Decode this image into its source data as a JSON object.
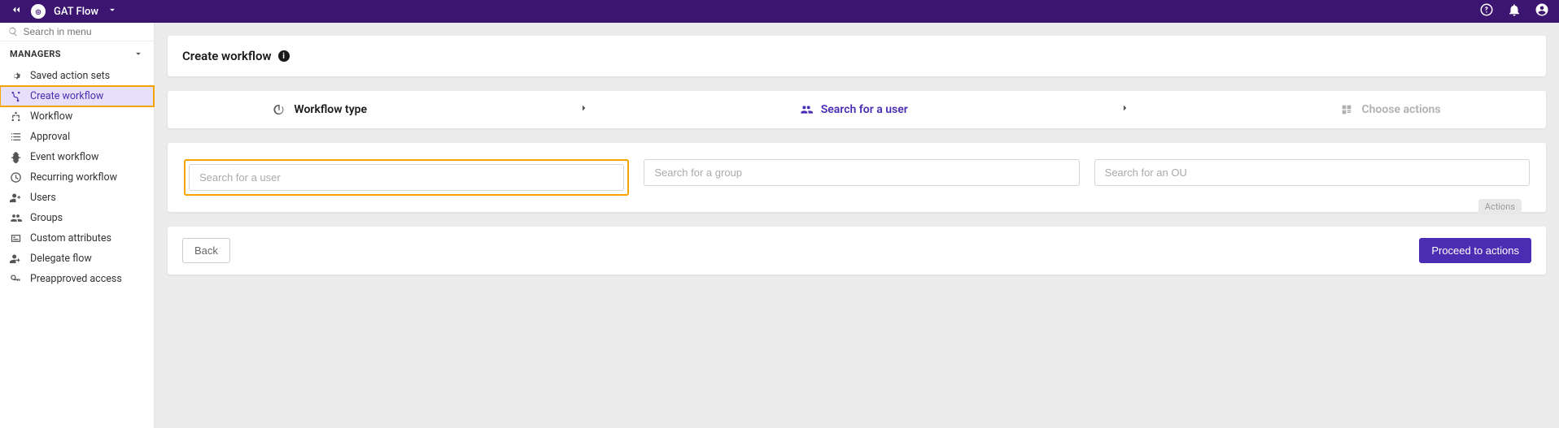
{
  "topbar": {
    "app_name": "GAT Flow"
  },
  "sidebar": {
    "search_placeholder": "Search in menu",
    "section_label": "MANAGERS",
    "items": [
      {
        "label": "Saved action sets"
      },
      {
        "label": "Create workflow"
      },
      {
        "label": "Workflow"
      },
      {
        "label": "Approval"
      },
      {
        "label": "Event workflow"
      },
      {
        "label": "Recurring workflow"
      },
      {
        "label": "Users"
      },
      {
        "label": "Groups"
      },
      {
        "label": "Custom attributes"
      },
      {
        "label": "Delegate flow"
      },
      {
        "label": "Preapproved access"
      }
    ]
  },
  "page": {
    "title": "Create workflow",
    "info_glyph": "i",
    "steps": {
      "type": "Workflow type",
      "search": "Search for a user",
      "actions": "Choose actions"
    },
    "search": {
      "user_placeholder": "Search for a user",
      "group_placeholder": "Search for a group",
      "ou_placeholder": "Search for an OU"
    },
    "buttons": {
      "back": "Back",
      "proceed": "Proceed to actions",
      "hint": "Actions"
    }
  }
}
